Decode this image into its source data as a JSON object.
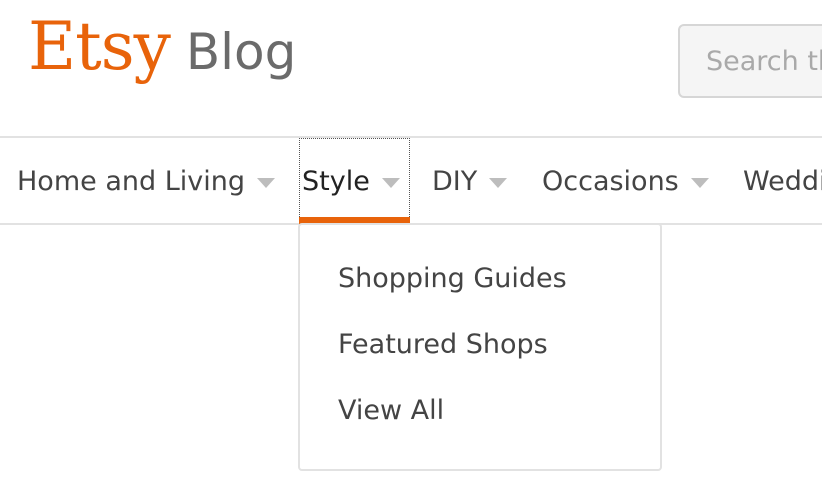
{
  "header": {
    "logo_brand": "Etsy",
    "logo_suffix": "Blog",
    "brand_color": "#e8630a"
  },
  "search": {
    "placeholder": "Search the blog",
    "value": ""
  },
  "nav": {
    "items": [
      {
        "label": "Home and Living",
        "icon": "caret-down-icon"
      },
      {
        "label": "Style",
        "icon": "caret-down-icon",
        "active": true
      },
      {
        "label": "DIY",
        "icon": "caret-down-icon"
      },
      {
        "label": "Occasions",
        "icon": "caret-down-icon"
      },
      {
        "label": "Weddings",
        "icon": "caret-down-icon"
      }
    ]
  },
  "dropdown": {
    "items": [
      {
        "label": "Shopping Guides"
      },
      {
        "label": "Featured Shops"
      },
      {
        "label": "View All"
      }
    ]
  }
}
